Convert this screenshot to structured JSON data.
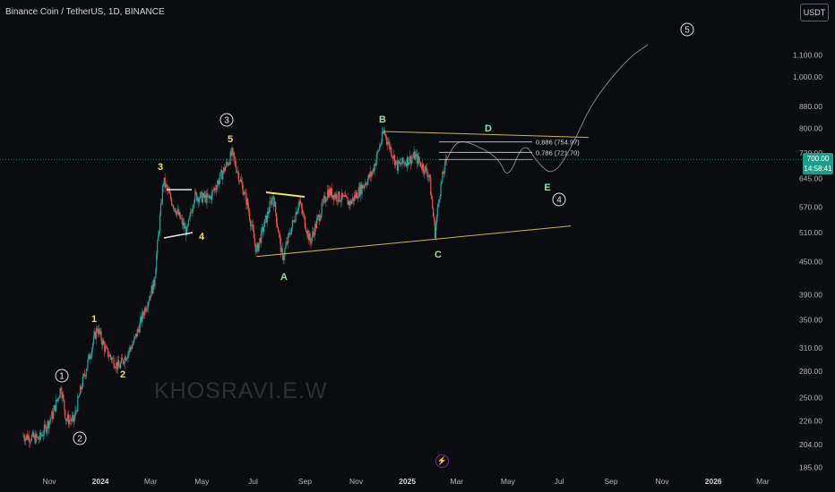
{
  "header": {
    "title": "Binance Coin / TetherUS, 1D, BINANCE",
    "currency": "USDT"
  },
  "watermark": "KHOSRAVI.E.W",
  "price_badge": {
    "price": "700.00",
    "countdown": "14:58:41"
  },
  "colors": {
    "background": "#0b0c10",
    "up": "#26a69a",
    "down": "#ef5350",
    "wave_yellow": "#e9e25a",
    "line_yellow": "#c8b84a",
    "white": "#e6e6e6",
    "green_label": "#9ed8a8"
  },
  "icons": [
    "flash-icon"
  ],
  "chart_data": {
    "type": "candlestick",
    "symbol": "Binance Coin / TetherUS",
    "interval": "1D",
    "exchange": "BINANCE",
    "y_scale": "log",
    "y_ticks": [
      1100,
      1000,
      880,
      800,
      720,
      645,
      570,
      510,
      450,
      390,
      350,
      310,
      280,
      250,
      226,
      204,
      185
    ],
    "y_tick_labels": [
      "1,100.00",
      "1,000.00",
      "880.00",
      "800.00",
      "720.00",
      "645.00",
      "570.00",
      "510.00",
      "450.00",
      "390.00",
      "350.00",
      "310.00",
      "280.00",
      "250.00",
      "226.00",
      "204.00",
      "185.00"
    ],
    "x_ticks": [
      "Nov",
      "2024",
      "Mar",
      "May",
      "Jul",
      "Sep",
      "Nov",
      "2025",
      "Mar",
      "May",
      "Jul",
      "Sep",
      "Nov",
      "2026",
      "Mar"
    ],
    "last_price": 700.0,
    "price_path": [
      [
        "2023-10-01",
        212
      ],
      [
        "2023-10-20",
        209
      ],
      [
        "2023-11-05",
        232
      ],
      [
        "2023-11-15",
        262
      ],
      [
        "2023-11-21",
        228
      ],
      [
        "2023-11-30",
        226
      ],
      [
        "2023-12-10",
        265
      ],
      [
        "2023-12-28",
        338
      ],
      [
        "2024-01-08",
        305
      ],
      [
        "2024-01-23",
        285
      ],
      [
        "2024-02-10",
        318
      ],
      [
        "2024-02-25",
        375
      ],
      [
        "2024-03-05",
        410
      ],
      [
        "2024-03-16",
        638
      ],
      [
        "2024-03-26",
        585
      ],
      [
        "2024-04-13",
        510
      ],
      [
        "2024-04-22",
        598
      ],
      [
        "2024-05-10",
        590
      ],
      [
        "2024-06-06",
        718
      ],
      [
        "2024-06-24",
        580
      ],
      [
        "2024-07-05",
        470
      ],
      [
        "2024-07-25",
        600
      ],
      [
        "2024-08-05",
        455
      ],
      [
        "2024-08-25",
        585
      ],
      [
        "2024-09-07",
        490
      ],
      [
        "2024-09-28",
        610
      ],
      [
        "2024-10-25",
        580
      ],
      [
        "2024-11-20",
        660
      ],
      [
        "2024-12-04",
        790
      ],
      [
        "2024-12-20",
        680
      ],
      [
        "2025-01-10",
        710
      ],
      [
        "2025-01-27",
        655
      ],
      [
        "2025-02-03",
        510
      ],
      [
        "2025-02-08",
        600
      ],
      [
        "2025-02-13",
        660
      ],
      [
        "2025-02-17",
        700
      ]
    ],
    "projection_path": [
      [
        "2025-02-17",
        700
      ],
      [
        "2025-03-01",
        760
      ],
      [
        "2025-03-20",
        750
      ],
      [
        "2025-04-20",
        705
      ],
      [
        "2025-05-01",
        640
      ],
      [
        "2025-05-20",
        760
      ],
      [
        "2025-06-05",
        690
      ],
      [
        "2025-06-25",
        650
      ],
      [
        "2025-07-20",
        760
      ],
      [
        "2025-08-10",
        900
      ],
      [
        "2025-09-20",
        1080
      ],
      [
        "2025-10-15",
        1150
      ]
    ],
    "fib_levels": [
      {
        "label": "0.886 (754.97)",
        "price": 754.97
      },
      {
        "label": "0.786 (721.70)",
        "price": 721.7
      }
    ],
    "wave_labels": {
      "primary_circled": [
        "1",
        "2",
        "3",
        "4",
        "5"
      ],
      "minor": [
        "1",
        "2",
        "3",
        "4",
        "5"
      ],
      "corrective": [
        "A",
        "B",
        "C",
        "D",
        "E"
      ]
    },
    "trendlines": [
      {
        "name": "triangle-upper",
        "from": [
          "2024-12-04",
          790
        ],
        "to": [
          "2025-08-05",
          770
        ]
      },
      {
        "name": "triangle-lower",
        "from": [
          "2024-07-05",
          460
        ],
        "to": [
          "2025-07-15",
          525
        ]
      }
    ],
    "grid": false,
    "legend": "none"
  }
}
